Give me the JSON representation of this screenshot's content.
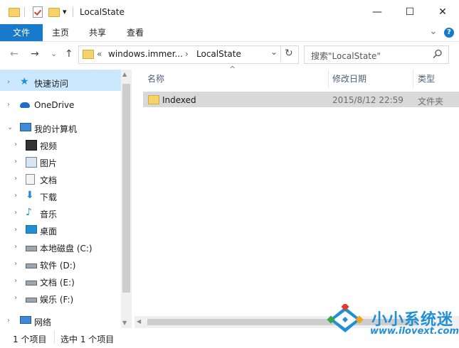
{
  "window": {
    "title": "LocalState",
    "dropdown_glyph": "▾",
    "minimize_glyph": "—",
    "maximize_glyph": "☐",
    "close_glyph": "✕"
  },
  "ribbon": {
    "tabs": [
      "文件",
      "主页",
      "共享",
      "查看"
    ],
    "expand_glyph": "⌄",
    "help_glyph": "?"
  },
  "address": {
    "overflow": "«",
    "crumbs": [
      "windows.immer...",
      "LocalState"
    ],
    "separator": "›",
    "dropdown_glyph": "⌄",
    "refresh_glyph": "↻",
    "search_placeholder": "搜索\"LocalState\"",
    "back_glyph": "←",
    "forward_glyph": "→",
    "recent_glyph": "⌄",
    "up_glyph": "↑"
  },
  "nav": {
    "items": [
      {
        "label": "快速访问",
        "icon": "star-icon"
      },
      {
        "label": "OneDrive",
        "icon": "cloud-icon"
      },
      {
        "label": "我的计算机",
        "icon": "computer-icon"
      },
      {
        "label": "视频",
        "icon": "video-icon"
      },
      {
        "label": "图片",
        "icon": "picture-icon"
      },
      {
        "label": "文档",
        "icon": "document-icon"
      },
      {
        "label": "下载",
        "icon": "download-icon"
      },
      {
        "label": "音乐",
        "icon": "music-icon"
      },
      {
        "label": "桌面",
        "icon": "desktop-icon"
      },
      {
        "label": "本地磁盘 (C:)",
        "icon": "local-disk-icon"
      },
      {
        "label": "软件 (D:)",
        "icon": "drive-icon"
      },
      {
        "label": "文档 (E:)",
        "icon": "drive-icon"
      },
      {
        "label": "娱乐 (F:)",
        "icon": "drive-icon"
      },
      {
        "label": "网络",
        "icon": "network-icon"
      }
    ],
    "chev_collapsed": "›",
    "chev_expanded": "⌄"
  },
  "columns": {
    "name": "名称",
    "modified": "修改日期",
    "type": "类型",
    "sort_glyph": "^"
  },
  "files": [
    {
      "name": "Indexed",
      "modified": "2015/8/12 22:59",
      "type": "文件夹"
    }
  ],
  "status": {
    "count": "1 个项目",
    "selected": "选中 1 个项目"
  },
  "watermark": {
    "brand": "小小系统迷",
    "url": "www.ilovext.com"
  }
}
